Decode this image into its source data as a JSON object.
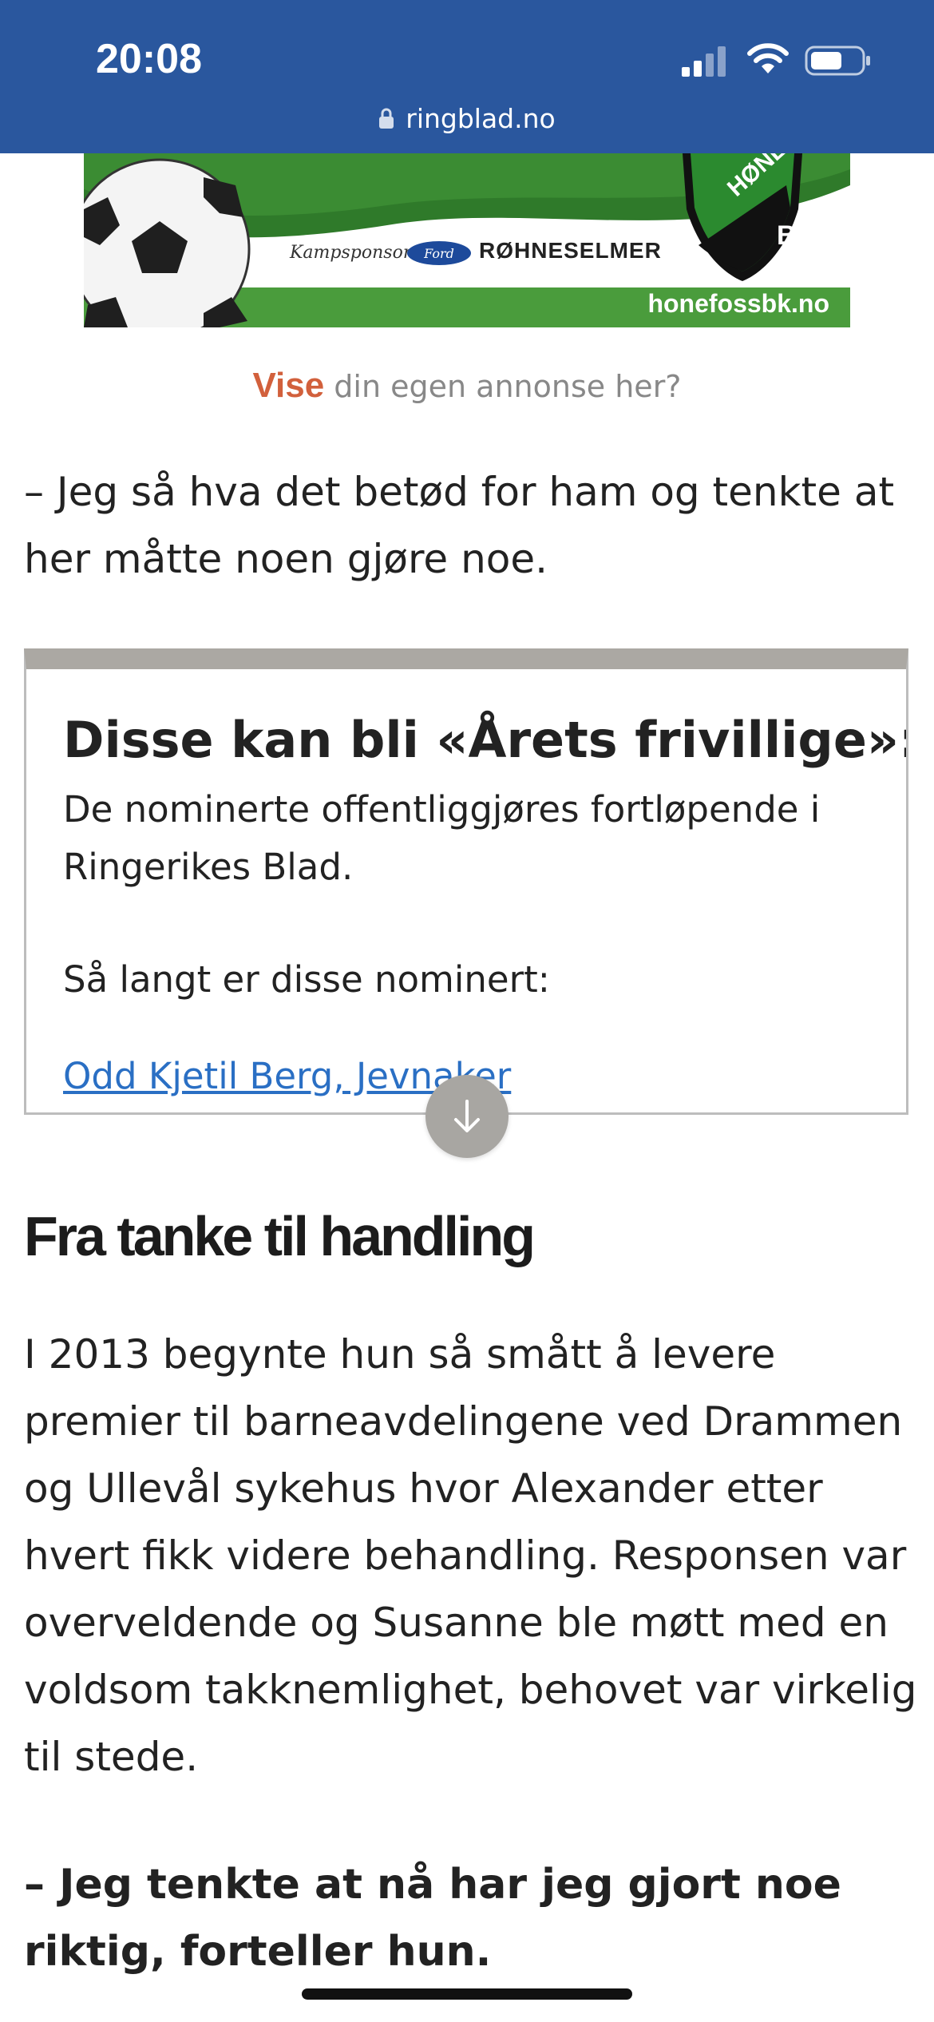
{
  "status_bar": {
    "time": "20:08",
    "url": "ringblad.no"
  },
  "ad": {
    "sponsor_label": "Kampsponsor:",
    "ford_logo_text": "Ford",
    "brand": "RØHNESELMER",
    "club_name": "HØNEFOSS",
    "club_abbrev": "BK",
    "domain": "honefossbk.no"
  },
  "ad_note": {
    "highlight": "Vise",
    "rest": " din egen annonse her?"
  },
  "article": {
    "quote1": "– Jeg så hva det betød for ham og tenkte at her måtte noen gjøre noe.",
    "factbox": {
      "title": "Disse kan bli «Årets frivillige»:",
      "text": "De nominerte offentliggjøres fortløpende i Ringerikes Blad.",
      "subtext": "Så langt er disse nominert:",
      "link": "Odd Kjetil Berg, Jevnaker"
    },
    "heading": "Fra tanke til handling",
    "paragraph": "I 2013 begynte hun så smått å levere premier til barneavdelingene ved Drammen og Ullevål sykehus hvor Alexander etter hvert fikk videre behandling. Responsen var overveldende og Susanne ble møtt med en voldsom takknemlighet, behovet var virkelig til stede.",
    "quote2": "– Jeg tenkte at nå har jeg gjort noe riktig, forteller hun."
  },
  "colors": {
    "topbar": "#2a579e",
    "link": "#2a6fc4",
    "vise_accent": "#d2603c",
    "factbox_bar": "#aba8a3",
    "ad_green": "#4a9c3c"
  },
  "icons": [
    "lock-icon",
    "signal-icon",
    "wifi-icon",
    "battery-icon",
    "soccer-ball-icon",
    "club-badge-icon",
    "arrow-down-icon"
  ]
}
